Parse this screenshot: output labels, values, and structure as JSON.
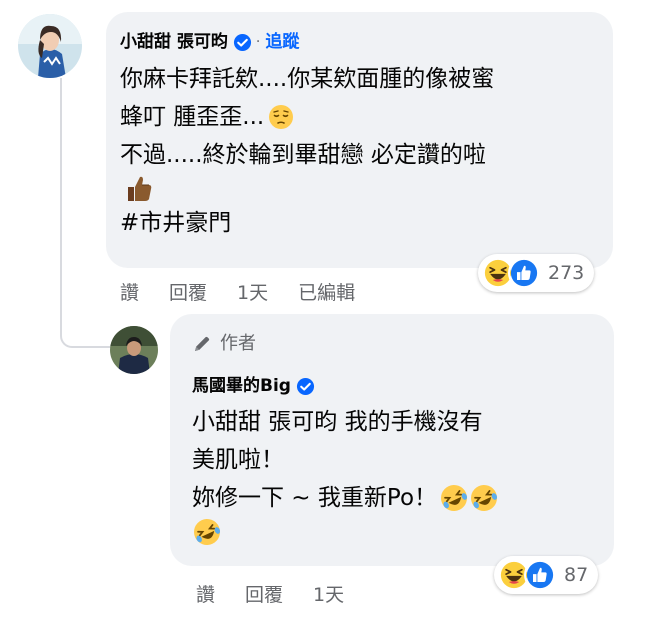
{
  "comment1": {
    "author": "小甜甜 張可昀",
    "dot": "·",
    "follow_label": "追蹤",
    "lines": {
      "l1": "你麻卡拜託欸....你某欸面腫的像被蜜",
      "l2": "蜂叮 腫歪歪...",
      "l3": "不過.....終於輪到畢甜戀 必定讚的啦",
      "l5": "#市井豪門"
    },
    "actions": {
      "like": "讚",
      "reply": "回覆",
      "time": "1天",
      "edited": "已編輯"
    },
    "reaction_count": "273"
  },
  "reply1": {
    "badge_label": "作者",
    "author": "馬國畢的Big",
    "lines": {
      "l1": "小甜甜 張可昀 我的手機沒有",
      "l2": "美肌啦！",
      "l3": "妳修一下 ~ 我重新Po！"
    },
    "actions": {
      "like": "讚",
      "reply": "回覆",
      "time": "1天"
    },
    "reaction_count": "87"
  },
  "colors": {
    "accent": "#0866ff",
    "bubble": "#f0f2f5",
    "secondary_text": "#65676b"
  }
}
